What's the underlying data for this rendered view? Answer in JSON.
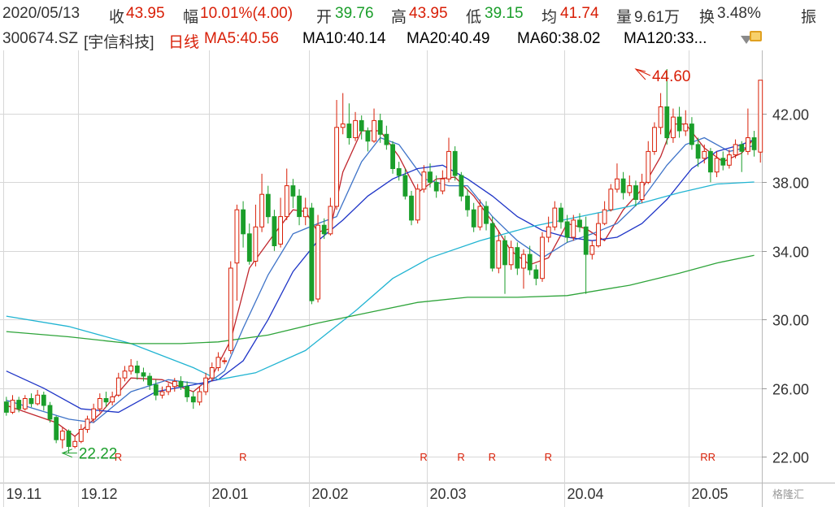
{
  "header": {
    "date": "2020/05/13",
    "close_label": "收",
    "close": "43.95",
    "change_label": "幅",
    "change": "10.01%(4.00)",
    "open_label": "开",
    "open": "39.76",
    "high_label": "高",
    "high": "43.95",
    "low_label": "低",
    "low": "39.15",
    "avg_label": "均",
    "avg": "41.74",
    "vol_label": "量",
    "vol": "9.61万",
    "turnover_label": "换",
    "turnover": "3.48%",
    "amp_label": "振"
  },
  "legend": {
    "code": "300674.SZ",
    "name": "[宇信科技]",
    "period": "日线",
    "ma5": "MA5:40.56",
    "ma10": "MA10:40.14",
    "ma20": "MA20:40.49",
    "ma60": "MA60:38.02",
    "ma120": "MA120:33..."
  },
  "watermark": "格隆汇",
  "colors": {
    "up": "#d81e06",
    "down": "#1a9e2a",
    "ma5": "#c0262d",
    "ma10": "#3e73c8",
    "ma20": "#1f35c7",
    "ma60": "#21b4d2",
    "ma120": "#2ea43a",
    "grid": "#d7d7d7"
  },
  "chart_data": {
    "type": "candlestick",
    "ylim": [
      20.5,
      45.5
    ],
    "y_ticks": [
      {
        "v": 22,
        "label": "22.00"
      },
      {
        "v": 26,
        "label": "26.00"
      },
      {
        "v": 30,
        "label": "30.00"
      },
      {
        "v": 34,
        "label": "34.00"
      },
      {
        "v": 38,
        "label": "38.00"
      },
      {
        "v": 42,
        "label": "42.00"
      }
    ],
    "x_ticks": [
      {
        "i": 0,
        "label": "19.11"
      },
      {
        "i": 12,
        "label": "19.12"
      },
      {
        "i": 33,
        "label": "20.01"
      },
      {
        "i": 49,
        "label": "20.02"
      },
      {
        "i": 68,
        "label": "20.03"
      },
      {
        "i": 90,
        "label": "20.04"
      },
      {
        "i": 110,
        "label": "20.05"
      }
    ],
    "r_markers": [
      {
        "i": 18,
        "label": "R"
      },
      {
        "i": 38,
        "label": "R"
      },
      {
        "i": 67,
        "label": "R"
      },
      {
        "i": 73,
        "label": "R"
      },
      {
        "i": 78,
        "label": "R"
      },
      {
        "i": 87,
        "label": "R"
      },
      {
        "i": 112,
        "label": "RR"
      }
    ],
    "annotations": [
      {
        "i": 9,
        "price": 22.22,
        "label": "22.22",
        "color": "#1a9e2a"
      },
      {
        "i": 101,
        "price": 44.6,
        "label": "44.60",
        "color": "#d81e06"
      }
    ],
    "candles": [
      [
        25.2,
        24.6,
        25.5,
        24.4
      ],
      [
        24.6,
        25.3,
        25.6,
        24.5
      ],
      [
        25.3,
        24.8,
        25.5,
        24.6
      ],
      [
        24.8,
        25.4,
        25.6,
        24.7
      ],
      [
        25.4,
        25.1,
        25.7,
        24.9
      ],
      [
        25.1,
        25.6,
        25.9,
        25.0
      ],
      [
        25.6,
        25.0,
        25.8,
        24.7
      ],
      [
        25.0,
        24.2,
        25.2,
        24.0
      ],
      [
        24.3,
        23.0,
        24.4,
        22.8
      ],
      [
        23.0,
        23.5,
        23.7,
        22.5
      ],
      [
        23.5,
        22.6,
        23.6,
        22.22
      ],
      [
        22.6,
        22.9,
        23.2,
        22.5
      ],
      [
        22.9,
        23.6,
        23.9,
        22.8
      ],
      [
        23.6,
        24.2,
        24.4,
        23.4
      ],
      [
        24.2,
        24.8,
        25.1,
        24.0
      ],
      [
        24.8,
        25.4,
        25.7,
        24.6
      ],
      [
        25.4,
        25.2,
        25.8,
        24.9
      ],
      [
        25.2,
        25.5,
        25.8,
        25.0
      ],
      [
        25.6,
        26.6,
        26.9,
        25.5
      ],
      [
        26.6,
        27.0,
        27.3,
        26.4
      ],
      [
        27.0,
        27.3,
        27.7,
        26.8
      ],
      [
        27.3,
        26.9,
        27.6,
        26.5
      ],
      [
        26.9,
        26.7,
        27.2,
        26.4
      ],
      [
        26.7,
        26.2,
        26.9,
        25.9
      ],
      [
        26.2,
        25.6,
        26.5,
        25.3
      ],
      [
        25.6,
        25.8,
        26.1,
        25.4
      ],
      [
        25.8,
        26.1,
        26.3,
        25.6
      ],
      [
        26.1,
        26.4,
        26.6,
        25.8
      ],
      [
        26.4,
        26.1,
        26.7,
        25.9
      ],
      [
        26.1,
        25.5,
        26.4,
        25.2
      ],
      [
        25.5,
        25.2,
        25.8,
        24.8
      ],
      [
        25.2,
        25.8,
        26.1,
        25.0
      ],
      [
        25.8,
        26.6,
        26.9,
        25.6
      ],
      [
        26.6,
        27.2,
        27.5,
        26.4
      ],
      [
        27.2,
        27.8,
        28.1,
        27.0
      ],
      [
        27.6,
        27.6,
        27.8,
        27.4
      ],
      [
        28.2,
        33.0,
        33.4,
        28.0
      ],
      [
        33.3,
        36.4,
        36.7,
        31.1
      ],
      [
        36.4,
        35.0,
        36.9,
        34.2
      ],
      [
        35.0,
        33.4,
        35.6,
        33.2
      ],
      [
        33.4,
        35.4,
        36.7,
        33.1
      ],
      [
        35.4,
        37.3,
        38.5,
        35.1
      ],
      [
        37.3,
        36.0,
        37.8,
        35.6
      ],
      [
        36.0,
        34.3,
        36.4,
        34.0
      ],
      [
        34.4,
        36.0,
        37.1,
        34.2
      ],
      [
        36.0,
        37.8,
        38.8,
        35.8
      ],
      [
        37.8,
        37.2,
        38.2,
        36.5
      ],
      [
        37.2,
        36.0,
        37.6,
        35.5
      ],
      [
        36.0,
        36.5,
        37.1,
        35.5
      ],
      [
        36.5,
        31.1,
        36.8,
        30.9
      ],
      [
        31.2,
        35.5,
        36.1,
        31.0
      ],
      [
        35.5,
        35.0,
        35.9,
        34.7
      ],
      [
        35.0,
        36.6,
        37.1,
        34.9
      ],
      [
        36.6,
        41.2,
        42.8,
        36.4
      ],
      [
        41.2,
        41.4,
        43.2,
        40.8
      ],
      [
        41.4,
        40.6,
        42.6,
        40.2
      ],
      [
        40.6,
        41.6,
        42.1,
        40.4
      ],
      [
        41.6,
        41.0,
        41.9,
        40.5
      ],
      [
        41.0,
        40.4,
        41.2,
        39.8
      ],
      [
        40.4,
        41.6,
        42.3,
        40.3
      ],
      [
        41.6,
        40.8,
        42.0,
        40.3
      ],
      [
        40.8,
        40.2,
        41.3,
        39.9
      ],
      [
        40.2,
        38.8,
        40.4,
        38.5
      ],
      [
        38.8,
        38.4,
        39.2,
        38.1
      ],
      [
        38.4,
        37.2,
        38.8,
        37.0
      ],
      [
        37.2,
        35.8,
        37.5,
        35.5
      ],
      [
        35.8,
        37.6,
        37.9,
        35.6
      ],
      [
        37.6,
        38.6,
        39.0,
        37.4
      ],
      [
        38.6,
        38.0,
        39.1,
        37.7
      ],
      [
        38.0,
        37.5,
        38.4,
        37.1
      ],
      [
        37.5,
        38.2,
        38.7,
        37.3
      ],
      [
        38.2,
        39.8,
        40.6,
        38.0
      ],
      [
        39.8,
        38.4,
        40.1,
        38.1
      ],
      [
        38.4,
        37.2,
        38.6,
        36.9
      ],
      [
        37.2,
        36.4,
        37.6,
        36.0
      ],
      [
        36.4,
        35.4,
        36.8,
        35.1
      ],
      [
        35.4,
        36.6,
        37.0,
        35.2
      ],
      [
        36.6,
        35.6,
        36.9,
        35.2
      ],
      [
        35.6,
        33.0,
        36.0,
        32.8
      ],
      [
        33.0,
        34.6,
        35.2,
        32.7
      ],
      [
        34.6,
        33.2,
        34.9,
        31.5
      ],
      [
        33.2,
        34.2,
        34.6,
        32.9
      ],
      [
        34.2,
        33.0,
        34.5,
        32.6
      ],
      [
        33.0,
        33.8,
        34.1,
        31.8
      ],
      [
        33.8,
        32.9,
        34.3,
        32.6
      ],
      [
        32.9,
        32.4,
        33.2,
        32.0
      ],
      [
        32.4,
        34.8,
        35.1,
        32.2
      ],
      [
        34.8,
        35.4,
        36.0,
        34.5
      ],
      [
        35.4,
        36.5,
        36.9,
        35.2
      ],
      [
        36.5,
        35.7,
        36.8,
        35.3
      ],
      [
        35.7,
        34.8,
        36.1,
        34.5
      ],
      [
        34.8,
        35.8,
        36.1,
        34.6
      ],
      [
        35.8,
        35.4,
        36.2,
        35.1
      ],
      [
        35.4,
        33.8,
        36.0,
        31.5
      ],
      [
        33.8,
        34.3,
        34.6,
        33.5
      ],
      [
        34.3,
        35.6,
        36.2,
        34.2
      ],
      [
        35.6,
        36.4,
        36.9,
        35.5
      ],
      [
        36.4,
        37.6,
        37.9,
        36.3
      ],
      [
        37.6,
        38.2,
        39.1,
        37.4
      ],
      [
        38.2,
        37.4,
        38.6,
        37.0
      ],
      [
        37.4,
        37.8,
        38.4,
        37.2
      ],
      [
        37.8,
        37.0,
        38.1,
        36.6
      ],
      [
        37.0,
        38.0,
        38.5,
        36.8
      ],
      [
        38.0,
        39.8,
        40.4,
        37.9
      ],
      [
        39.8,
        41.2,
        41.5,
        39.6
      ],
      [
        41.2,
        42.4,
        43.2,
        40.8
      ],
      [
        42.4,
        40.6,
        44.6,
        40.2
      ],
      [
        40.6,
        41.8,
        42.3,
        40.3
      ],
      [
        41.8,
        41.0,
        42.4,
        40.6
      ],
      [
        41.0,
        41.4,
        42.2,
        40.7
      ],
      [
        41.4,
        40.2,
        41.8,
        39.9
      ],
      [
        40.2,
        39.4,
        40.6,
        38.9
      ],
      [
        39.4,
        39.8,
        40.2,
        39.1
      ],
      [
        39.8,
        38.6,
        40.0,
        38.0
      ],
      [
        38.6,
        39.4,
        39.8,
        38.3
      ],
      [
        39.4,
        39.0,
        39.8,
        38.7
      ],
      [
        39.0,
        39.6,
        39.9,
        38.8
      ],
      [
        39.6,
        40.2,
        40.5,
        39.4
      ],
      [
        40.2,
        39.8,
        40.4,
        38.6
      ],
      [
        39.8,
        40.6,
        42.3,
        39.6
      ],
      [
        40.6,
        39.9,
        41.0,
        39.5
      ],
      [
        39.76,
        43.95,
        43.95,
        39.15
      ]
    ],
    "ma_lines": [
      {
        "name": "MA5",
        "color": "#c0262d",
        "knots": [
          [
            0,
            25.0
          ],
          [
            8,
            24.0
          ],
          [
            11,
            23.2
          ],
          [
            15,
            24.5
          ],
          [
            20,
            26.6
          ],
          [
            25,
            26.5
          ],
          [
            30,
            25.8
          ],
          [
            33,
            26.7
          ],
          [
            36,
            28.8
          ],
          [
            39,
            33.0
          ],
          [
            43,
            35.0
          ],
          [
            46,
            36.4
          ],
          [
            48,
            36.3
          ],
          [
            50,
            35.1
          ],
          [
            52,
            35.3
          ],
          [
            54,
            38.6
          ],
          [
            57,
            41.0
          ],
          [
            60,
            41.0
          ],
          [
            63,
            39.5
          ],
          [
            66,
            37.4
          ],
          [
            69,
            38.2
          ],
          [
            72,
            38.3
          ],
          [
            75,
            37.2
          ],
          [
            78,
            35.7
          ],
          [
            81,
            34.0
          ],
          [
            84,
            33.2
          ],
          [
            87,
            33.6
          ],
          [
            90,
            35.6
          ],
          [
            93,
            35.3
          ],
          [
            96,
            34.6
          ],
          [
            99,
            36.4
          ],
          [
            102,
            37.6
          ],
          [
            105,
            39.5
          ],
          [
            107,
            41.4
          ],
          [
            109,
            41.4
          ],
          [
            112,
            40.0
          ],
          [
            115,
            39.2
          ],
          [
            118,
            39.7
          ],
          [
            120,
            40.56
          ]
        ]
      },
      {
        "name": "MA10",
        "color": "#3e73c8",
        "knots": [
          [
            0,
            25.3
          ],
          [
            10,
            24.2
          ],
          [
            14,
            24.0
          ],
          [
            20,
            25.8
          ],
          [
            26,
            26.5
          ],
          [
            32,
            26.2
          ],
          [
            35,
            27.0
          ],
          [
            38,
            29.5
          ],
          [
            42,
            32.6
          ],
          [
            46,
            35.0
          ],
          [
            50,
            35.6
          ],
          [
            53,
            36.0
          ],
          [
            57,
            39.2
          ],
          [
            60,
            40.6
          ],
          [
            63,
            40.2
          ],
          [
            67,
            38.2
          ],
          [
            71,
            37.8
          ],
          [
            74,
            37.8
          ],
          [
            78,
            36.0
          ],
          [
            82,
            34.6
          ],
          [
            86,
            33.6
          ],
          [
            90,
            34.5
          ],
          [
            94,
            35.0
          ],
          [
            98,
            35.6
          ],
          [
            102,
            37.0
          ],
          [
            106,
            39.0
          ],
          [
            109,
            40.2
          ],
          [
            112,
            40.6
          ],
          [
            116,
            39.8
          ],
          [
            120,
            40.14
          ]
        ]
      },
      {
        "name": "MA20",
        "color": "#1f35c7",
        "knots": [
          [
            0,
            27.0
          ],
          [
            6,
            26.0
          ],
          [
            12,
            24.8
          ],
          [
            18,
            24.6
          ],
          [
            24,
            25.8
          ],
          [
            30,
            26.2
          ],
          [
            34,
            26.5
          ],
          [
            38,
            27.6
          ],
          [
            42,
            30.0
          ],
          [
            46,
            32.8
          ],
          [
            50,
            34.6
          ],
          [
            54,
            35.8
          ],
          [
            58,
            37.2
          ],
          [
            62,
            38.2
          ],
          [
            66,
            38.8
          ],
          [
            70,
            39.0
          ],
          [
            74,
            38.2
          ],
          [
            78,
            37.2
          ],
          [
            82,
            36.0
          ],
          [
            86,
            35.2
          ],
          [
            90,
            34.8
          ],
          [
            94,
            34.6
          ],
          [
            98,
            34.8
          ],
          [
            102,
            35.6
          ],
          [
            106,
            37.0
          ],
          [
            110,
            38.8
          ],
          [
            114,
            39.8
          ],
          [
            118,
            40.2
          ],
          [
            120,
            40.49
          ]
        ]
      },
      {
        "name": "MA60",
        "color": "#21b4d2",
        "knots": [
          [
            0,
            30.2
          ],
          [
            10,
            29.6
          ],
          [
            20,
            28.6
          ],
          [
            30,
            27.2
          ],
          [
            34,
            26.5
          ],
          [
            40,
            26.9
          ],
          [
            48,
            28.2
          ],
          [
            56,
            30.5
          ],
          [
            62,
            32.4
          ],
          [
            68,
            33.6
          ],
          [
            76,
            34.6
          ],
          [
            84,
            35.4
          ],
          [
            92,
            36.0
          ],
          [
            100,
            36.6
          ],
          [
            108,
            37.4
          ],
          [
            114,
            37.9
          ],
          [
            120,
            38.02
          ]
        ]
      },
      {
        "name": "MA120",
        "color": "#2ea43a",
        "knots": [
          [
            0,
            29.3
          ],
          [
            10,
            29.0
          ],
          [
            20,
            28.6
          ],
          [
            28,
            28.6
          ],
          [
            34,
            28.7
          ],
          [
            42,
            29.1
          ],
          [
            50,
            29.8
          ],
          [
            58,
            30.4
          ],
          [
            66,
            31.0
          ],
          [
            74,
            31.3
          ],
          [
            82,
            31.3
          ],
          [
            90,
            31.4
          ],
          [
            100,
            32.0
          ],
          [
            108,
            32.7
          ],
          [
            114,
            33.3
          ],
          [
            120,
            33.75
          ]
        ]
      }
    ]
  }
}
